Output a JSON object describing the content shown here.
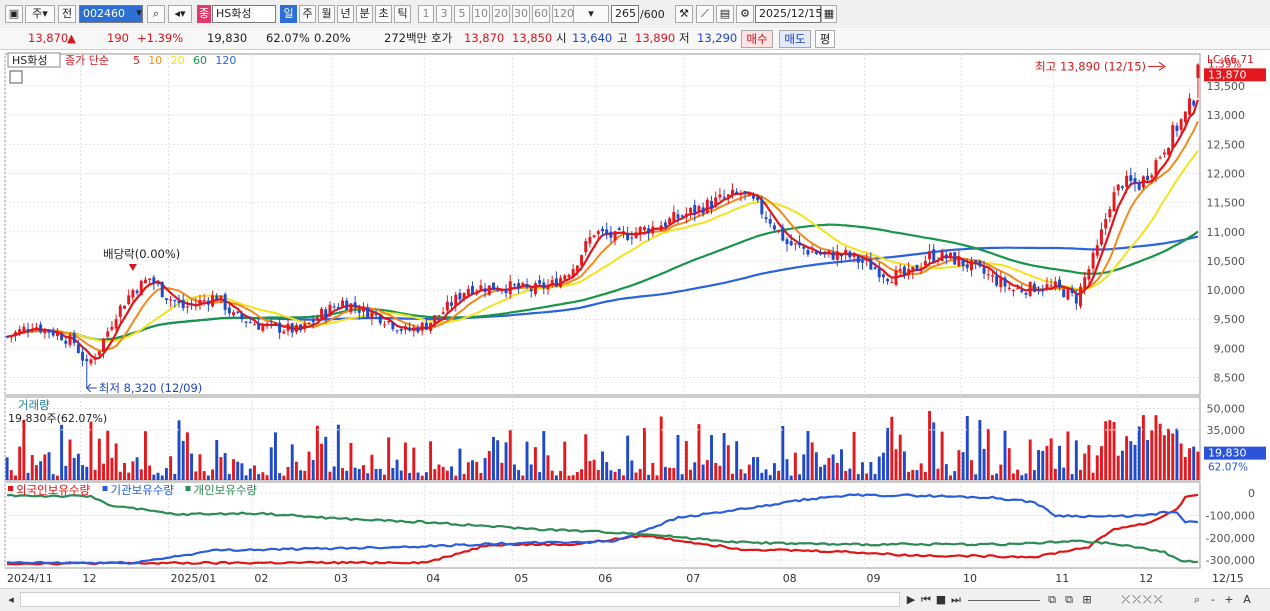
{
  "toolbar": {
    "type_label": "주",
    "period_prefix": "전",
    "code": "002460",
    "name": "HS화성",
    "name_badge": "종",
    "periods": [
      "일",
      "주",
      "월",
      "년",
      "분",
      "초",
      "틱"
    ],
    "selected_period": "일",
    "minutes": [
      "1",
      "3",
      "5",
      "10",
      "20",
      "30",
      "60",
      "120"
    ],
    "count": "265",
    "count_total": "/600",
    "date": "2025/12/15"
  },
  "quote": {
    "price": "13,870",
    "arrow": "▲",
    "change": "190",
    "pct": "+1.39%",
    "volume": "19,830",
    "vol_ratio": "62.07%",
    "turnover_rate": "0.20%",
    "amount": "272백만",
    "ask_label": "호가",
    "ask": "13,870",
    "bid": "13,850",
    "open_label": "시",
    "open": "13,640",
    "high_label": "고",
    "high": "13,890",
    "low_label": "저",
    "low": "13,290",
    "buy": "매수",
    "sell": "매도",
    "eval": "평"
  },
  "colors": {
    "up": "#e3191f",
    "down": "#1f49c8",
    "ma5": "#e0161c",
    "ma10": "#f08a1c",
    "ma20": "#f4e21a",
    "ma60": "#199448",
    "ma120": "#2b63dc",
    "foreign": "#e01515",
    "inst": "#2a5cdc",
    "indiv": "#2e8a55"
  },
  "chart_data": [
    {
      "type": "candlestick",
      "title": "HS화성",
      "legend": [
        "종가 단순",
        "5",
        "10",
        "20",
        "60",
        "120"
      ],
      "x": [
        "2024/11",
        "12",
        "2025/01",
        "02",
        "03",
        "04",
        "05",
        "06",
        "07",
        "08",
        "09",
        "10",
        "11",
        "12",
        "12/15"
      ],
      "y_ticks": [
        8500,
        9000,
        9500,
        10000,
        10500,
        11000,
        11500,
        12000,
        12500,
        13000,
        13500
      ],
      "ylim": [
        8200,
        14050
      ],
      "close_anchors": [
        [
          0,
          9200
        ],
        [
          6,
          9400
        ],
        [
          12,
          9250
        ],
        [
          16,
          9100
        ],
        [
          19,
          8700
        ],
        [
          22,
          9000
        ],
        [
          26,
          9600
        ],
        [
          30,
          10000
        ],
        [
          34,
          10200
        ],
        [
          38,
          9900
        ],
        [
          42,
          9700
        ],
        [
          46,
          9800
        ],
        [
          50,
          9900
        ],
        [
          54,
          9550
        ],
        [
          60,
          9400
        ],
        [
          65,
          9350
        ],
        [
          70,
          9300
        ],
        [
          75,
          9600
        ],
        [
          80,
          9800
        ],
        [
          85,
          9650
        ],
        [
          90,
          9500
        ],
        [
          95,
          9300
        ],
        [
          100,
          9400
        ],
        [
          105,
          9700
        ],
        [
          110,
          10050
        ],
        [
          115,
          10050
        ],
        [
          120,
          10050
        ],
        [
          125,
          10000
        ],
        [
          130,
          10100
        ],
        [
          135,
          10400
        ],
        [
          140,
          11000
        ],
        [
          145,
          10900
        ],
        [
          150,
          11000
        ],
        [
          155,
          11100
        ],
        [
          160,
          11250
        ],
        [
          165,
          11400
        ],
        [
          170,
          11550
        ],
        [
          175,
          11650
        ],
        [
          178,
          11500
        ],
        [
          182,
          11200
        ],
        [
          186,
          10800
        ],
        [
          190,
          10700
        ],
        [
          195,
          10600
        ],
        [
          200,
          10600
        ],
        [
          205,
          10450
        ],
        [
          210,
          10250
        ],
        [
          215,
          10250
        ],
        [
          220,
          10600
        ],
        [
          225,
          10550
        ],
        [
          230,
          10400
        ],
        [
          235,
          10200
        ],
        [
          240,
          10000
        ],
        [
          245,
          10050
        ],
        [
          250,
          10050
        ],
        [
          255,
          9850
        ],
        [
          257,
          10200
        ],
        [
          260,
          10700
        ],
        [
          263,
          11500
        ],
        [
          266,
          11850
        ],
        [
          270,
          11800
        ],
        [
          274,
          12200
        ],
        [
          278,
          12700
        ],
        [
          281,
          13000
        ],
        [
          283,
          13300
        ],
        [
          284,
          13870
        ]
      ],
      "annotations": [
        {
          "text": "최고 13,890 (12/15)",
          "value": 13890
        },
        {
          "text": "최저 8,320 (12/09)",
          "value": 8320
        },
        {
          "text": "배당락(0.00%)"
        }
      ],
      "right_labels": {
        "top": "LC:66.71",
        "pct": "1.39%",
        "price": "13,870"
      }
    },
    {
      "type": "bar",
      "title": "거래량",
      "subtitle": "19,830주(62.07%)",
      "y_ticks": [
        35000,
        50000
      ],
      "ylim": [
        0,
        58000
      ],
      "last_value": 19830,
      "right_labels": {
        "value": "19,830",
        "pct": "62.07%",
        "tick_50k": "50,000",
        "tick_35k": "35,000"
      }
    },
    {
      "type": "line",
      "legend": [
        "외국인보유수량",
        "기관보유수량",
        "개인보유수량"
      ],
      "y_ticks": [
        0,
        -100000,
        -200000,
        -300000
      ],
      "ylim": [
        -335000,
        50000
      ],
      "series": [
        {
          "name": "외국인보유수량",
          "points": [
            [
              0,
              -315000
            ],
            [
              100,
              -310000
            ],
            [
              115,
              -230000
            ],
            [
              135,
              -230000
            ],
            [
              152,
              -190000
            ],
            [
              175,
              -250000
            ],
            [
              200,
              -262000
            ],
            [
              215,
              -278000
            ],
            [
              245,
              -285000
            ],
            [
              258,
              -240000
            ],
            [
              264,
              -160000
            ],
            [
              272,
              -135000
            ],
            [
              276,
              -100000
            ],
            [
              279,
              -70000
            ],
            [
              281,
              -20000
            ],
            [
              284,
              -5000
            ]
          ]
        },
        {
          "name": "기관보유수량",
          "points": [
            [
              0,
              -312000
            ],
            [
              30,
              -312000
            ],
            [
              50,
              -255000
            ],
            [
              70,
              -250000
            ],
            [
              95,
              -240000
            ],
            [
              120,
              -225000
            ],
            [
              145,
              -215000
            ],
            [
              150,
              -180000
            ],
            [
              160,
              -110000
            ],
            [
              180,
              -60000
            ],
            [
              190,
              -30000
            ],
            [
              200,
              -10000
            ],
            [
              215,
              -10000
            ],
            [
              235,
              -20000
            ],
            [
              245,
              -40000
            ],
            [
              250,
              -100000
            ],
            [
              262,
              -105000
            ],
            [
              272,
              -100000
            ],
            [
              276,
              -85000
            ],
            [
              279,
              -90000
            ],
            [
              281,
              -130000
            ],
            [
              284,
              -125000
            ]
          ]
        },
        {
          "name": "개인보유수량",
          "points": [
            [
              0,
              -10000
            ],
            [
              20,
              -15000
            ],
            [
              25,
              -55000
            ],
            [
              40,
              -95000
            ],
            [
              60,
              -90000
            ],
            [
              80,
              -115000
            ],
            [
              100,
              -130000
            ],
            [
              125,
              -160000
            ],
            [
              150,
              -180000
            ],
            [
              175,
              -220000
            ],
            [
              200,
              -230000
            ],
            [
              240,
              -228000
            ],
            [
              255,
              -215000
            ],
            [
              263,
              -225000
            ],
            [
              272,
              -250000
            ],
            [
              276,
              -265000
            ],
            [
              280,
              -300000
            ],
            [
              284,
              -310000
            ]
          ]
        }
      ],
      "right_labels": {
        "t0": "0",
        "t1": "-100,000",
        "t2": "-200,000",
        "t3": "-300,000"
      }
    }
  ],
  "statusbar": {
    "zoom_minus": "-",
    "zoom_plus": "+",
    "font": "A"
  }
}
